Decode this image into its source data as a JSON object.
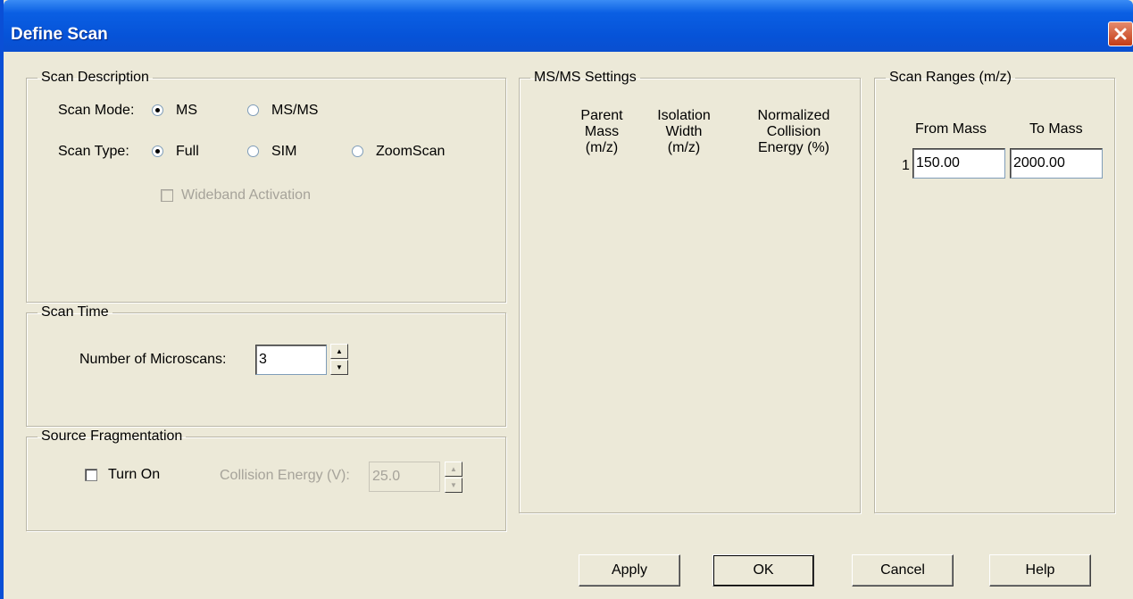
{
  "window": {
    "title": "Define Scan",
    "close_label": "✕"
  },
  "scan_description": {
    "legend": "Scan Description",
    "scan_mode_label": "Scan Mode:",
    "scan_mode_options": [
      "MS",
      "MS/MS"
    ],
    "scan_mode_selected": "MS",
    "scan_type_label": "Scan Type:",
    "scan_type_options": [
      "Full",
      "SIM",
      "ZoomScan"
    ],
    "scan_type_selected": "Full",
    "wideband_label": "Wideband Activation"
  },
  "scan_time": {
    "legend": "Scan Time",
    "microscans_label": "Number of Microscans:",
    "microscans_value": "3"
  },
  "source_fragmentation": {
    "legend": "Source Fragmentation",
    "turn_on_label": "Turn On",
    "collision_label": "Collision Energy (V):",
    "collision_value": "25.0"
  },
  "msms_settings": {
    "legend": "MS/MS Settings",
    "col_parent": [
      "Parent",
      "Mass",
      "(m/z)"
    ],
    "col_isolation": [
      "Isolation",
      "Width",
      "(m/z)"
    ],
    "col_energy": [
      "Normalized",
      "Collision",
      "Energy (%)"
    ]
  },
  "scan_ranges": {
    "legend": "Scan Ranges (m/z)",
    "from_header": "From Mass",
    "to_header": "To Mass",
    "rows": [
      {
        "index": "1",
        "from": "150.00",
        "to": "2000.00"
      }
    ]
  },
  "buttons": {
    "apply": "Apply",
    "ok": "OK",
    "cancel": "Cancel",
    "help": "Help"
  }
}
